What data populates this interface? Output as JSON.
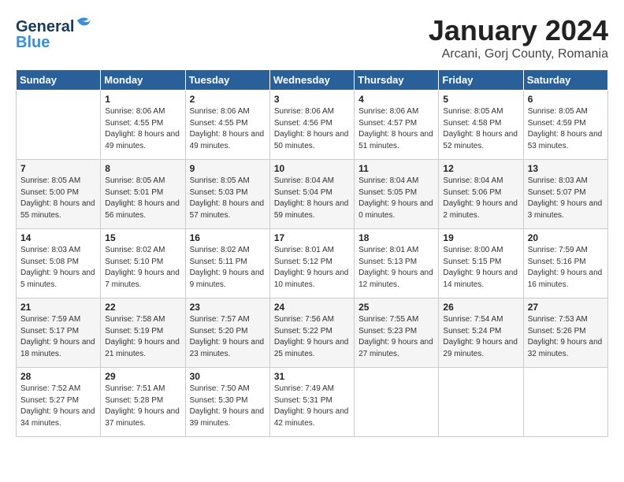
{
  "header": {
    "logo_general": "General",
    "logo_blue": "Blue",
    "month_title": "January 2024",
    "location": "Arcani, Gorj County, Romania"
  },
  "weekdays": [
    "Sunday",
    "Monday",
    "Tuesday",
    "Wednesday",
    "Thursday",
    "Friday",
    "Saturday"
  ],
  "weeks": [
    [
      {
        "day": "",
        "sunrise": "",
        "sunset": "",
        "daylight": ""
      },
      {
        "day": "1",
        "sunrise": "Sunrise: 8:06 AM",
        "sunset": "Sunset: 4:55 PM",
        "daylight": "Daylight: 8 hours and 49 minutes."
      },
      {
        "day": "2",
        "sunrise": "Sunrise: 8:06 AM",
        "sunset": "Sunset: 4:55 PM",
        "daylight": "Daylight: 8 hours and 49 minutes."
      },
      {
        "day": "3",
        "sunrise": "Sunrise: 8:06 AM",
        "sunset": "Sunset: 4:56 PM",
        "daylight": "Daylight: 8 hours and 50 minutes."
      },
      {
        "day": "4",
        "sunrise": "Sunrise: 8:06 AM",
        "sunset": "Sunset: 4:57 PM",
        "daylight": "Daylight: 8 hours and 51 minutes."
      },
      {
        "day": "5",
        "sunrise": "Sunrise: 8:05 AM",
        "sunset": "Sunset: 4:58 PM",
        "daylight": "Daylight: 8 hours and 52 minutes."
      },
      {
        "day": "6",
        "sunrise": "Sunrise: 8:05 AM",
        "sunset": "Sunset: 4:59 PM",
        "daylight": "Daylight: 8 hours and 53 minutes."
      }
    ],
    [
      {
        "day": "7",
        "sunrise": "Sunrise: 8:05 AM",
        "sunset": "Sunset: 5:00 PM",
        "daylight": "Daylight: 8 hours and 55 minutes."
      },
      {
        "day": "8",
        "sunrise": "Sunrise: 8:05 AM",
        "sunset": "Sunset: 5:01 PM",
        "daylight": "Daylight: 8 hours and 56 minutes."
      },
      {
        "day": "9",
        "sunrise": "Sunrise: 8:05 AM",
        "sunset": "Sunset: 5:03 PM",
        "daylight": "Daylight: 8 hours and 57 minutes."
      },
      {
        "day": "10",
        "sunrise": "Sunrise: 8:04 AM",
        "sunset": "Sunset: 5:04 PM",
        "daylight": "Daylight: 8 hours and 59 minutes."
      },
      {
        "day": "11",
        "sunrise": "Sunrise: 8:04 AM",
        "sunset": "Sunset: 5:05 PM",
        "daylight": "Daylight: 9 hours and 0 minutes."
      },
      {
        "day": "12",
        "sunrise": "Sunrise: 8:04 AM",
        "sunset": "Sunset: 5:06 PM",
        "daylight": "Daylight: 9 hours and 2 minutes."
      },
      {
        "day": "13",
        "sunrise": "Sunrise: 8:03 AM",
        "sunset": "Sunset: 5:07 PM",
        "daylight": "Daylight: 9 hours and 3 minutes."
      }
    ],
    [
      {
        "day": "14",
        "sunrise": "Sunrise: 8:03 AM",
        "sunset": "Sunset: 5:08 PM",
        "daylight": "Daylight: 9 hours and 5 minutes."
      },
      {
        "day": "15",
        "sunrise": "Sunrise: 8:02 AM",
        "sunset": "Sunset: 5:10 PM",
        "daylight": "Daylight: 9 hours and 7 minutes."
      },
      {
        "day": "16",
        "sunrise": "Sunrise: 8:02 AM",
        "sunset": "Sunset: 5:11 PM",
        "daylight": "Daylight: 9 hours and 9 minutes."
      },
      {
        "day": "17",
        "sunrise": "Sunrise: 8:01 AM",
        "sunset": "Sunset: 5:12 PM",
        "daylight": "Daylight: 9 hours and 10 minutes."
      },
      {
        "day": "18",
        "sunrise": "Sunrise: 8:01 AM",
        "sunset": "Sunset: 5:13 PM",
        "daylight": "Daylight: 9 hours and 12 minutes."
      },
      {
        "day": "19",
        "sunrise": "Sunrise: 8:00 AM",
        "sunset": "Sunset: 5:15 PM",
        "daylight": "Daylight: 9 hours and 14 minutes."
      },
      {
        "day": "20",
        "sunrise": "Sunrise: 7:59 AM",
        "sunset": "Sunset: 5:16 PM",
        "daylight": "Daylight: 9 hours and 16 minutes."
      }
    ],
    [
      {
        "day": "21",
        "sunrise": "Sunrise: 7:59 AM",
        "sunset": "Sunset: 5:17 PM",
        "daylight": "Daylight: 9 hours and 18 minutes."
      },
      {
        "day": "22",
        "sunrise": "Sunrise: 7:58 AM",
        "sunset": "Sunset: 5:19 PM",
        "daylight": "Daylight: 9 hours and 21 minutes."
      },
      {
        "day": "23",
        "sunrise": "Sunrise: 7:57 AM",
        "sunset": "Sunset: 5:20 PM",
        "daylight": "Daylight: 9 hours and 23 minutes."
      },
      {
        "day": "24",
        "sunrise": "Sunrise: 7:56 AM",
        "sunset": "Sunset: 5:22 PM",
        "daylight": "Daylight: 9 hours and 25 minutes."
      },
      {
        "day": "25",
        "sunrise": "Sunrise: 7:55 AM",
        "sunset": "Sunset: 5:23 PM",
        "daylight": "Daylight: 9 hours and 27 minutes."
      },
      {
        "day": "26",
        "sunrise": "Sunrise: 7:54 AM",
        "sunset": "Sunset: 5:24 PM",
        "daylight": "Daylight: 9 hours and 29 minutes."
      },
      {
        "day": "27",
        "sunrise": "Sunrise: 7:53 AM",
        "sunset": "Sunset: 5:26 PM",
        "daylight": "Daylight: 9 hours and 32 minutes."
      }
    ],
    [
      {
        "day": "28",
        "sunrise": "Sunrise: 7:52 AM",
        "sunset": "Sunset: 5:27 PM",
        "daylight": "Daylight: 9 hours and 34 minutes."
      },
      {
        "day": "29",
        "sunrise": "Sunrise: 7:51 AM",
        "sunset": "Sunset: 5:28 PM",
        "daylight": "Daylight: 9 hours and 37 minutes."
      },
      {
        "day": "30",
        "sunrise": "Sunrise: 7:50 AM",
        "sunset": "Sunset: 5:30 PM",
        "daylight": "Daylight: 9 hours and 39 minutes."
      },
      {
        "day": "31",
        "sunrise": "Sunrise: 7:49 AM",
        "sunset": "Sunset: 5:31 PM",
        "daylight": "Daylight: 9 hours and 42 minutes."
      },
      {
        "day": "",
        "sunrise": "",
        "sunset": "",
        "daylight": ""
      },
      {
        "day": "",
        "sunrise": "",
        "sunset": "",
        "daylight": ""
      },
      {
        "day": "",
        "sunrise": "",
        "sunset": "",
        "daylight": ""
      }
    ]
  ]
}
